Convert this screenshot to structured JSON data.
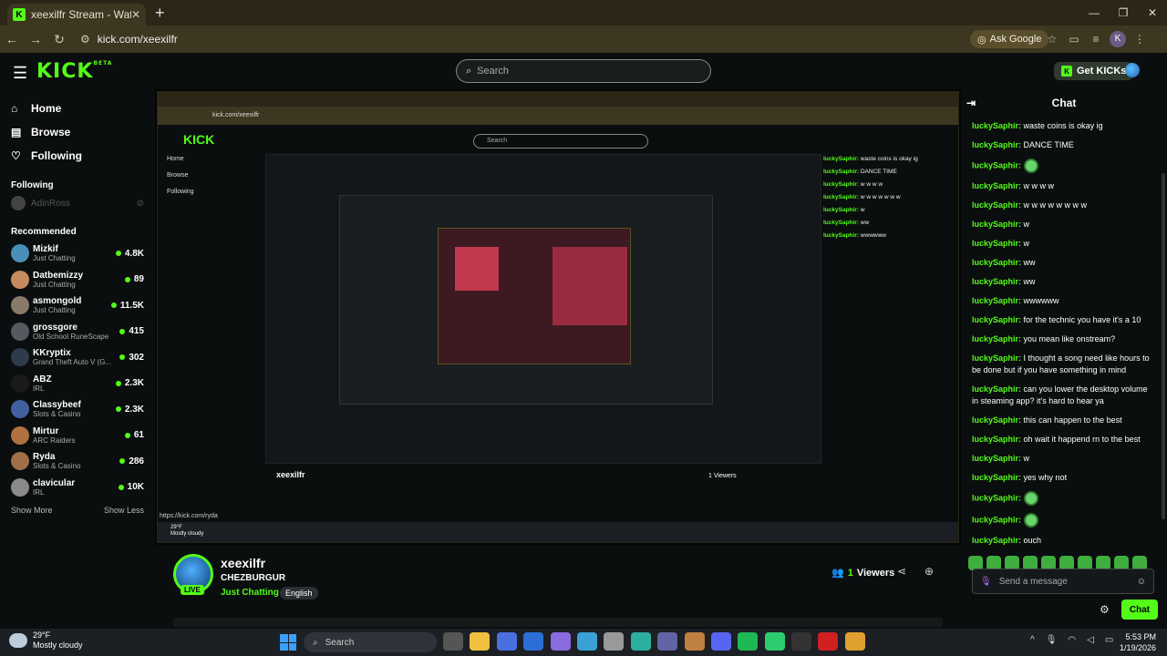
{
  "browser": {
    "tab_title": "xeexilfr Stream - Watch Live",
    "tab_favicon": "K",
    "new_tab": "+",
    "url": "kick.com/xeexilfr",
    "ask_google": "Ask Google",
    "profile": "K",
    "window_controls": [
      "—",
      "❐",
      "✕"
    ]
  },
  "header": {
    "logo": "KICK",
    "logo_badge": "BETA",
    "search_placeholder": "Search",
    "get_kicks": "Get KICKs"
  },
  "sidebar": {
    "nav": [
      {
        "label": "Home",
        "icon": "home-icon"
      },
      {
        "label": "Browse",
        "icon": "browse-icon"
      },
      {
        "label": "Following",
        "icon": "heart-icon"
      }
    ],
    "following_heading": "Following",
    "following": [
      {
        "name": "AdinRoss"
      }
    ],
    "recommended_heading": "Recommended",
    "recommended": [
      {
        "name": "Mizkif",
        "category": "Just Chatting",
        "viewers": "4.8K",
        "color": "#4a8fb8"
      },
      {
        "name": "Datbemizzy",
        "category": "Just Chatting",
        "viewers": "89",
        "color": "#c58b5e"
      },
      {
        "name": "asmongold",
        "category": "Just Chatting",
        "viewers": "11.5K",
        "color": "#8a7a6a"
      },
      {
        "name": "grossgore",
        "category": "Old School RuneScape",
        "viewers": "415",
        "color": "#555a60"
      },
      {
        "name": "KKryptix",
        "category": "Grand Theft Auto V (G...",
        "viewers": "302",
        "color": "#2f3a4a"
      },
      {
        "name": "ABZ",
        "category": "IRL",
        "viewers": "2.3K",
        "color": "#1a1a1a"
      },
      {
        "name": "Classybeef",
        "category": "Slots & Casino",
        "viewers": "2.3K",
        "color": "#4060a0"
      },
      {
        "name": "Mirtur",
        "category": "ARC Raiders",
        "viewers": "61",
        "color": "#b07040"
      },
      {
        "name": "Ryda",
        "category": "Slots & Casino",
        "viewers": "286",
        "color": "#a0704a"
      },
      {
        "name": "clavicular",
        "category": "IRL",
        "viewers": "10K",
        "color": "#8a8a8a"
      }
    ],
    "show_more": "Show More",
    "show_less": "Show Less"
  },
  "player": {
    "inner_url": "kick.com/xeexilfr",
    "inner_search": "Search",
    "inner_nav": [
      "Home",
      "Browse",
      "Following"
    ],
    "inner_chat": [
      {
        "u": "luckySaphir:",
        "m": "waste coins is okay ig"
      },
      {
        "u": "luckySaphir:",
        "m": "DANCE TIME"
      },
      {
        "u": "luckySaphir:",
        "m": "w w w w"
      },
      {
        "u": "luckySaphir:",
        "m": "w w w w w w w"
      },
      {
        "u": "luckySaphir:",
        "m": "w"
      },
      {
        "u": "luckySaphir:",
        "m": "ww"
      },
      {
        "u": "luckySaphir:",
        "m": "wwwwww"
      }
    ],
    "status_url": "https://kick.com/ryda",
    "inner_weather_temp": "29°F",
    "inner_weather_desc": "Mostly cloudy",
    "inner_streamer": "xeexilfr",
    "inner_viewers": "1 Viewers"
  },
  "stream": {
    "name": "xeexilfr",
    "title": "CHEZBURGUR",
    "category": "Just Chatting",
    "language": "English",
    "live": "LIVE",
    "viewers": "1",
    "viewers_label": "Viewers"
  },
  "chat": {
    "title": "Chat",
    "messages": [
      {
        "user": "luckySaphir:",
        "text": "waste coins is okay ig"
      },
      {
        "user": "luckySaphir:",
        "text": "DANCE TIME"
      },
      {
        "user": "luckySaphir:",
        "text": "",
        "emote": true
      },
      {
        "user": "luckySaphir:",
        "text": "w w w w"
      },
      {
        "user": "luckySaphir:",
        "text": "w w w w w w w w"
      },
      {
        "user": "luckySaphir:",
        "text": "w"
      },
      {
        "user": "luckySaphir:",
        "text": "w"
      },
      {
        "user": "luckySaphir:",
        "text": "ww"
      },
      {
        "user": "luckySaphir:",
        "text": "ww"
      },
      {
        "user": "luckySaphir:",
        "text": "wwwwww"
      },
      {
        "user": "luckySaphir:",
        "text": "for the technic you have it's a 10"
      },
      {
        "user": "luckySaphir:",
        "text": "you mean like onstream?"
      },
      {
        "user": "luckySaphir:",
        "text": "I thought a song need like hours to be done but if you have something in mind"
      },
      {
        "user": "luckySaphir:",
        "text": "can you lower the desktop volume in steaming app? it's hard to hear ya"
      },
      {
        "user": "luckySaphir:",
        "text": "this can happen to the best"
      },
      {
        "user": "luckySaphir:",
        "text": "oh wait it happend rn to the best"
      },
      {
        "user": "luckySaphir:",
        "text": "w"
      },
      {
        "user": "luckySaphir:",
        "text": "yes why not"
      },
      {
        "user": "luckySaphir:",
        "text": "",
        "emote": true
      },
      {
        "user": "luckySaphir:",
        "text": "",
        "emote": true
      },
      {
        "user": "luckySaphir:",
        "text": "ouch"
      }
    ],
    "input_placeholder": "Send a message",
    "send_button": "Chat"
  },
  "taskbar": {
    "weather_temp": "29°F",
    "weather_desc": "Mostly cloudy",
    "weather_badge": "1",
    "search_placeholder": "Search",
    "time": "5:53 PM",
    "date": "1/19/2026",
    "apps": [
      {
        "name": "task-view-icon",
        "color": "#555"
      },
      {
        "name": "file-explorer-icon",
        "color": "#f0c040"
      },
      {
        "name": "store-icon",
        "color": "#4a70e0"
      },
      {
        "name": "hp-icon",
        "color": "#2b6fd6"
      },
      {
        "name": "copilot-icon",
        "color": "#8a6be0"
      },
      {
        "name": "app-icon",
        "color": "#3aa0d6"
      },
      {
        "name": "calendar-icon",
        "color": "#999"
      },
      {
        "name": "edge-icon",
        "color": "#2bb0a0"
      },
      {
        "name": "teams-icon",
        "color": "#6264a7"
      },
      {
        "name": "photos-icon",
        "color": "#c08040"
      },
      {
        "name": "discord-icon",
        "color": "#5865f2"
      },
      {
        "name": "spotify-icon",
        "color": "#1db954"
      },
      {
        "name": "green-app-icon",
        "color": "#2ecc71"
      },
      {
        "name": "terminal-icon",
        "color": "#333"
      },
      {
        "name": "obs-icon",
        "color": "#d02020"
      },
      {
        "name": "chrome-icon",
        "color": "#e0a030"
      }
    ]
  },
  "colors": {
    "accent": "#53fc18",
    "background": "#0b0e0f",
    "browser_frame": "#2b2616"
  }
}
